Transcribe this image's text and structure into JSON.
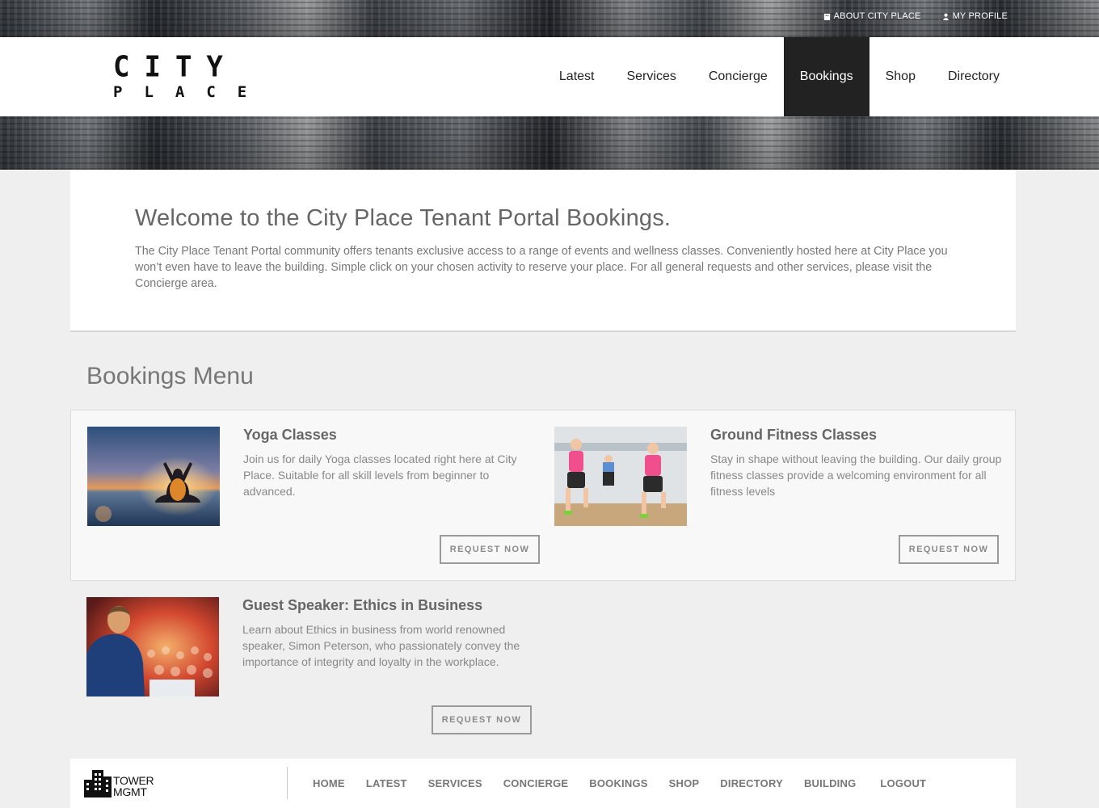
{
  "top_bar": {
    "links": [
      {
        "label": "ABOUT CITY PLACE",
        "icon": "building-icon"
      },
      {
        "label": "MY PROFILE",
        "icon": "user-icon"
      }
    ]
  },
  "header": {
    "logo_line1": "CITY",
    "logo_line2": "PLACE",
    "nav": [
      {
        "label": "Latest",
        "active": false
      },
      {
        "label": "Services",
        "active": false
      },
      {
        "label": "Concierge",
        "active": false
      },
      {
        "label": "Bookings",
        "active": true
      },
      {
        "label": "Shop",
        "active": false
      },
      {
        "label": "Directory",
        "active": false
      }
    ]
  },
  "welcome": {
    "title": "Welcome to the City Place Tenant Portal Bookings.",
    "body": "The City Place Tenant Portal community offers tenants exclusive access to a range of events and wellness classes. Conveniently hosted here at City Place you won’t even have to leave the building. Simple click on your chosen activity to reserve your place. For all general requests and other services, please visit the Concierge area."
  },
  "bookings": {
    "title": "Bookings Menu",
    "items": [
      {
        "title": "Yoga Classes",
        "description": "Join us for daily Yoga classes located right here at City Place. Suitable for all skill levels from beginner to advanced.",
        "button": "REQUEST NOW"
      },
      {
        "title": "Ground Fitness Classes",
        "description": "Stay in shape without leaving the building. Our daily group fitness classes provide a welcoming environment for all fitness levels",
        "button": "REQUEST NOW"
      },
      {
        "title": "Guest Speaker: Ethics in Business",
        "description": "Learn about Ethics in business from world renowned speaker, Simon Peterson, who passionately convey the importance of integrity and loyalty in the workplace.",
        "button": "REQUEST NOW"
      }
    ]
  },
  "footer": {
    "logo_line1": "TOWER",
    "logo_line2": "MGMT",
    "nav": [
      "HOME",
      "LATEST",
      "SERVICES",
      "CONCIERGE",
      "BOOKINGS",
      "SHOP",
      "DIRECTORY",
      "BUILDING",
      "LOGOUT"
    ]
  },
  "colors": {
    "active_nav_bg": "#222222",
    "page_bg": "#efefef",
    "text_gray": "#777777"
  }
}
